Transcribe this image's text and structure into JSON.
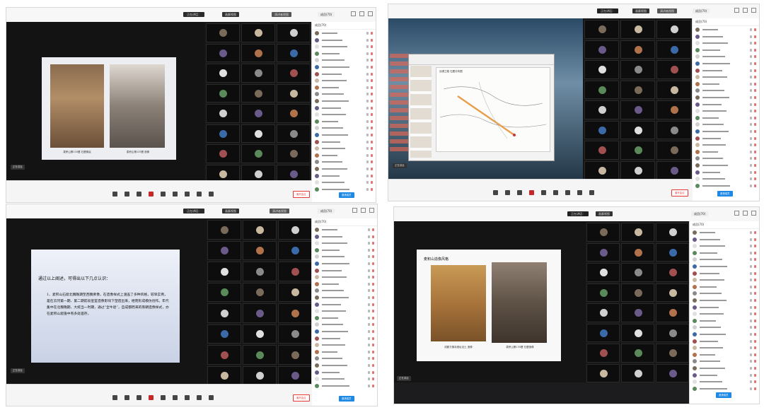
{
  "colors": {
    "accent": "#1e88e5",
    "leave": "#e53935",
    "dark": "#1c1c1e"
  },
  "toolbar_icons": [
    "mic-icon",
    "camera-icon",
    "share-icon",
    "record-icon",
    "members-icon",
    "chat-icon",
    "more-icon",
    "settings-icon",
    "grid-icon"
  ],
  "panels": [
    {
      "title": "正在讲话：",
      "gallery_title": "画廊视图",
      "view_label": "演讲者视图",
      "participants_header": "成员(70)",
      "slide_captions": [
        "麦积山第133窟 石窟佛龛",
        "麦积山第133窟 造像"
      ],
      "presenter_badge": "正在讲话",
      "leave": "离开会议",
      "invite": "邀请成员"
    },
    {
      "title": "正在讲话：",
      "gallery_title": "画廊视图",
      "view_label": "演讲者视图",
      "participants_header": "成员(70)",
      "presenter_badge": "正在讲话",
      "leave": "离开会议",
      "invite": "邀请成员",
      "map_title": "丝绸之路 石窟分布图"
    },
    {
      "title": "正在讲话：",
      "gallery_title": "画廊视图",
      "view_label": "演讲者视图",
      "participants_header": "成员(70)",
      "slide_heading": "通过以上阐述，可得出以下几点认识：",
      "slide_body": "1、麦积山石窟北魏晚期至西魏佛像，在造像样式上涵盖了多种风格，较早实例，是在云冈第一期、第二期前段皇室造像影响下塑造出来，继而形成模仿创作。年代集中在北魏晚期、大统当一时期，通过“全牛退”，自成都而来的南朝造像样式，亦在麦积山窟龛中有多处遗存。",
      "presenter_badge": "正在讲话",
      "leave": "离开会议",
      "invite": "邀请成员"
    },
    {
      "title": "正在讲话：",
      "gallery_title": "画廊视图",
      "view_label": "演讲者视图",
      "participants_header": "成员(70)",
      "slide_heading": "麦积山造像风格",
      "slide_captions": [
        "成都万佛寺遗址出土 造像",
        "麦积山第133窟 石窟造像"
      ],
      "presenter_badge": "正在讲话",
      "leave": "离开会议",
      "invite": "邀请成员"
    }
  ]
}
